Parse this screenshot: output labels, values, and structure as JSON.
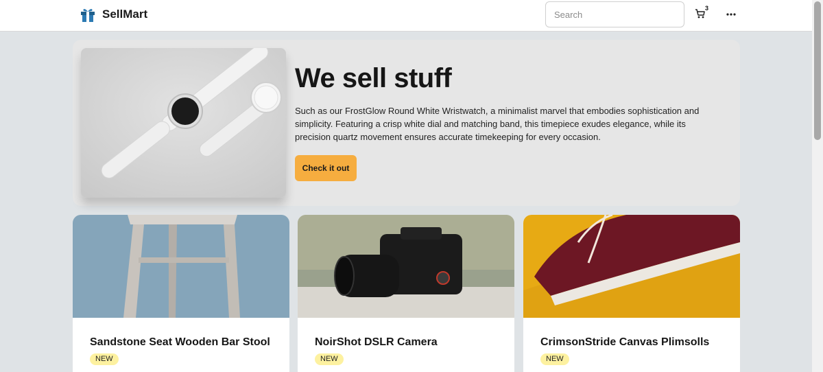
{
  "header": {
    "brand_name": "SellMart",
    "brand_icon": "gift-icon",
    "search_placeholder": "Search",
    "cart_icon": "shopping-cart-icon",
    "cart_count": "3",
    "more_icon": "more-horizontal-icon"
  },
  "hero": {
    "title": "We sell stuff",
    "description": "Such as our FrostGlow Round White Wristwatch, a minimalist marvel that embodies sophistication and simplicity. Featuring a crisp white dial and matching band, this timepiece exudes elegance, while its precision quartz movement ensures accurate timekeeping for every occasion.",
    "cta_label": "Check it out"
  },
  "products": [
    {
      "title": "Sandstone Seat Wooden Bar Stool",
      "badge": "NEW"
    },
    {
      "title": "NoirShot DSLR Camera",
      "badge": "NEW"
    },
    {
      "title": "CrimsonStride Canvas Plimsolls",
      "badge": "NEW"
    }
  ],
  "colors": {
    "accent": "#f6ad3f",
    "badge": "#fdf1a0",
    "page_bg": "#dfe3e6",
    "hero_bg": "#e6e6e6"
  }
}
